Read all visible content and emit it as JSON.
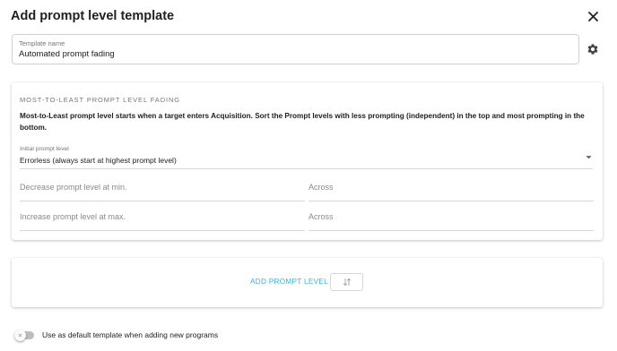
{
  "dialog": {
    "title": "Add prompt level template",
    "close_icon": "close-icon"
  },
  "template_name": {
    "label": "Template name",
    "value": "Automated prompt fading",
    "settings_icon": "gear-icon"
  },
  "fading": {
    "section_title": "MOST-TO-LEAST PROMPT LEVEL FADING",
    "description": "Most-to-Least prompt level starts when a target enters Acquisition. Sort the Prompt levels with less prompting (independent) in the top and most prompting in the bottom.",
    "initial_prompt": {
      "label": "Initial prompt level",
      "value": "Errorless (always start at highest prompt level)"
    },
    "decrease": {
      "placeholder": "Decrease prompt level at min.",
      "across_placeholder": "Across"
    },
    "increase": {
      "placeholder": "Increase prompt level at max.",
      "across_placeholder": "Across"
    }
  },
  "add_prompt": {
    "label": "ADD PROMPT LEVEL",
    "sort_icon": "sort-icon"
  },
  "default_toggle": {
    "label": "Use as default template when adding new programs",
    "checked": false
  },
  "colors": {
    "accent": "#39b4d8",
    "text": "#212121",
    "muted": "#757575"
  }
}
